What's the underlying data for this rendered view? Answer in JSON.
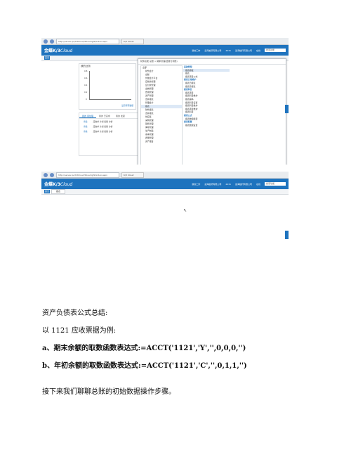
{
  "shot1": {
    "browser": {
      "address": "http://server-pc/K3Cloud/Silverlight/index.aspx",
      "tab": "K/3 Cloud"
    },
    "app": {
      "logo_main": "金蝶K/3",
      "logo_sub": "Cloud",
      "top_menu": [
        "我的工作",
        "蓝海柏轩有限公司",
        "2015",
        "蓝海柏轩有限公司",
        "在线"
      ],
      "search_placeholder": "搜索功能"
    },
    "tabs": {
      "home": "首页"
    },
    "chart_panel": {
      "title": "我的业务",
      "y_ticks": [
        "0.8",
        "0.6",
        "0.4",
        "0.2",
        "0"
      ],
      "link": "显示所有数据"
    },
    "list_panel": {
      "tabs": [
        "我的 待处理",
        "我的 已完成",
        "我的 发起"
      ],
      "rows": [
        {
          "link": "查看",
          "text": "应收单 计划 提醒 分析"
        },
        {
          "link": "查看",
          "text": "应收单 计划 提醒 分析"
        },
        {
          "link": "查看",
          "text": "应收单 计划 提醒 分析"
        }
      ]
    },
    "popup": {
      "header": "财务功能   总账  >  期末处理(结账与调整)",
      "tree": [
        {
          "label": "全部",
          "root": true
        },
        {
          "label": "财务会计"
        },
        {
          "label": "总账"
        },
        {
          "label": "智能会计平台"
        },
        {
          "label": "应收款管理"
        },
        {
          "label": "应付款管理"
        },
        {
          "label": "出纳管理"
        },
        {
          "label": "费用管理"
        },
        {
          "label": "资产管理"
        },
        {
          "label": "合并报表"
        },
        {
          "label": "管理会计"
        },
        {
          "label": "报表",
          "selected": true
        },
        {
          "label": "财务报表"
        },
        {
          "label": "合并报表"
        },
        {
          "label": "供应链"
        },
        {
          "label": "采购管理"
        },
        {
          "label": "销售管理"
        },
        {
          "label": "库存管理"
        },
        {
          "label": "生产制造"
        },
        {
          "label": "成本管理"
        },
        {
          "label": "质量管理"
        },
        {
          "label": "资产报告"
        }
      ],
      "right": [
        {
          "label": "基础管理",
          "hdr": true
        },
        {
          "label": "报表模板",
          "sel": true
        },
        {
          "label": "报表"
        },
        {
          "label": "报表项目公式"
        },
        {
          "label": "报表日常维护",
          "hdr": true
        },
        {
          "label": "报表日报表"
        },
        {
          "label": "报表月报表"
        },
        {
          "label": "报表科目",
          "hdr": true
        },
        {
          "label": "报表项目"
        },
        {
          "label": "报表科目维护"
        },
        {
          "label": "报表编码"
        },
        {
          "label": "报表科目设置"
        },
        {
          "label": "报表科目维护"
        },
        {
          "label": "报表项目维护"
        },
        {
          "label": "报表科目"
        },
        {
          "label": "报表公式",
          "hdr": true
        },
        {
          "label": "报表数据模型"
        },
        {
          "label": "报表配置",
          "hdr": true
        },
        {
          "label": "报表数据设置"
        }
      ]
    }
  },
  "shot2": {
    "browser": {
      "address": "http://server-pc/K3Cloud/Silverlight/index.aspx",
      "tab": "K/3 Cloud"
    },
    "app": {
      "logo_main": "金蝶K/3",
      "logo_sub": "Cloud",
      "top_menu": [
        "我的工作",
        "蓝海柏轩有限公司",
        "2015",
        "蓝海柏轩有限公司",
        "在线"
      ],
      "search_placeholder": "搜索功能"
    },
    "tabs": {
      "home": "首页",
      "page": "报表"
    }
  },
  "text": {
    "summary_title": "资产负债表公式总结:",
    "example_intro": "以 1121 应收票据为例:",
    "a_label": "a、期末余额的取数函数表达式:",
    "a_formula": "=ACCT('1121','Y','',0,0,0,'')",
    "b_label": "b、年初余额的取数函数表达式:",
    "b_formula": "=ACCT('1121','C','',0,1,1,'')",
    "next": "接下来我们聊聊总账的初始数据操作步骤。"
  }
}
